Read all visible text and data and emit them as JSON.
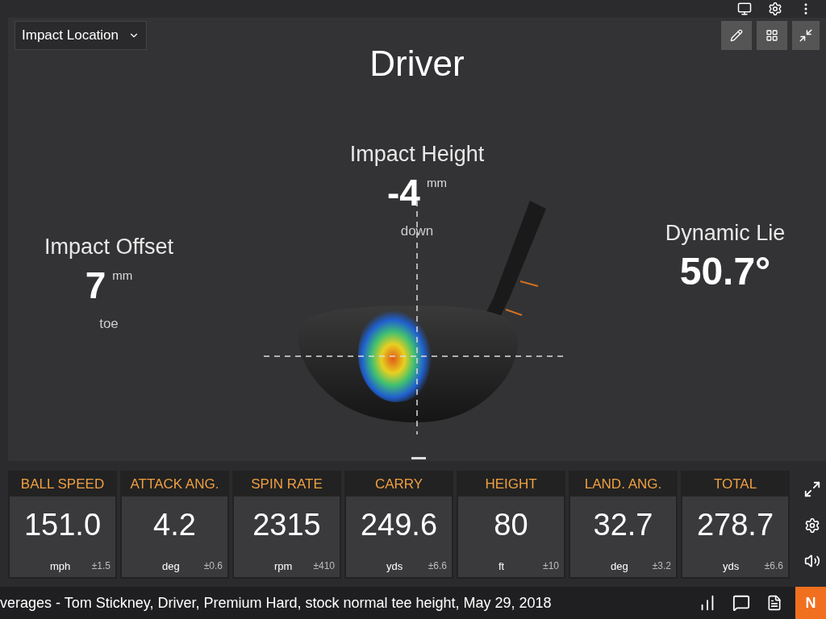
{
  "dropdown": {
    "value": "Impact Location"
  },
  "title": "Driver",
  "impact_height": {
    "label": "Impact Height",
    "value": "-4",
    "unit": "mm",
    "direction": "down"
  },
  "impact_offset": {
    "label": "Impact Offset",
    "value": "7",
    "unit": "mm",
    "direction": "toe"
  },
  "dynamic_lie": {
    "label": "Dynamic Lie",
    "value": "50.7°"
  },
  "tiles": [
    {
      "label": "BALL SPEED",
      "value": "151.0",
      "unit": "mph",
      "spread": "±1.5"
    },
    {
      "label": "ATTACK ANG.",
      "value": "4.2",
      "unit": "deg",
      "spread": "±0.6"
    },
    {
      "label": "SPIN RATE",
      "value": "2315",
      "unit": "rpm",
      "spread": "±410"
    },
    {
      "label": "CARRY",
      "value": "249.6",
      "unit": "yds",
      "spread": "±6.6"
    },
    {
      "label": "HEIGHT",
      "value": "80",
      "unit": "ft",
      "spread": "±10"
    },
    {
      "label": "LAND. ANG.",
      "value": "32.7",
      "unit": "deg",
      "spread": "±3.2"
    },
    {
      "label": "TOTAL",
      "value": "278.7",
      "unit": "yds",
      "spread": "±6.6"
    }
  ],
  "status_bar": {
    "text": "verages - Tom Stickney, Driver, Premium Hard, stock normal tee height, May 29, 2018",
    "badge": "N"
  }
}
